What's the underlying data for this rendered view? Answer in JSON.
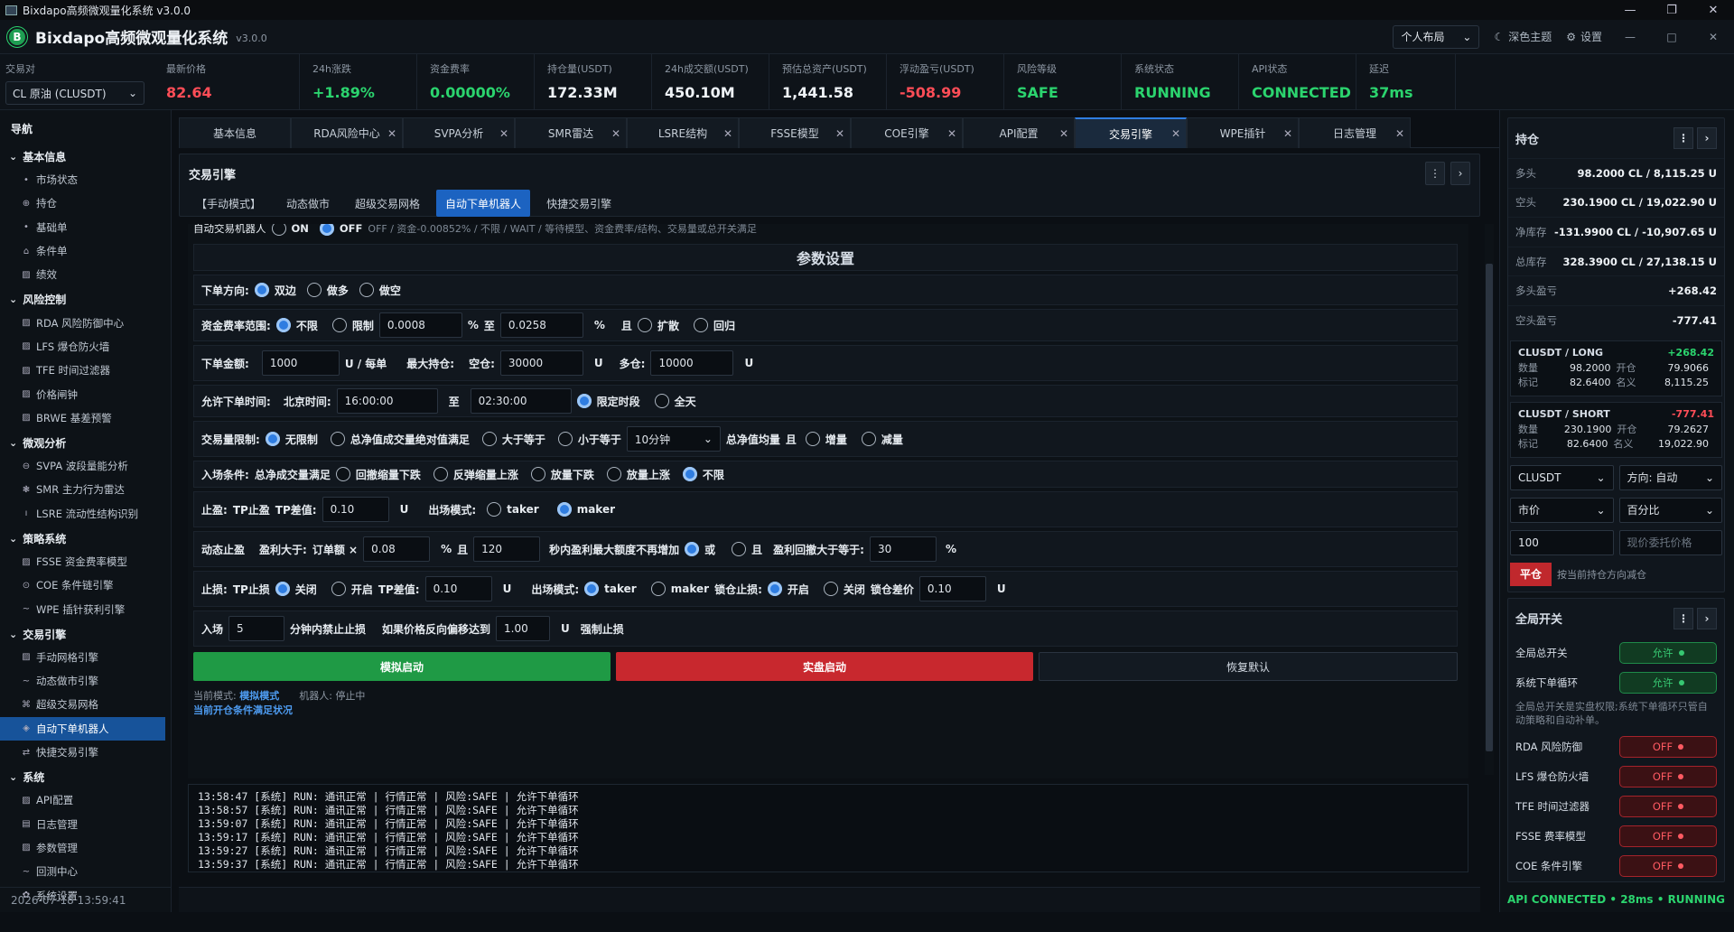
{
  "window": {
    "title": "Bixdapo高频微观量化系统 v3.0.0",
    "min": "—",
    "max": "❐",
    "close": "✕"
  },
  "app": {
    "logo": "B",
    "title": "Bixdapo高频微观量化系统",
    "version": "v3.0.0",
    "layout": "个人布局",
    "theme": "深色主题",
    "settings": "设置",
    "min": "—",
    "max": "□",
    "close": "✕"
  },
  "pair": {
    "label": "交易对",
    "value": "CL 原油 (CLUSDT)"
  },
  "stats": [
    {
      "label": "最新价格",
      "value": "82.64",
      "color": "#ff4d57"
    },
    {
      "label": "24h涨跌",
      "value": "+1.89%",
      "color": "#2bd46e"
    },
    {
      "label": "资金费率",
      "value": "0.00000%",
      "color": "#2bd46e"
    },
    {
      "label": "持仓量(USDT)",
      "value": "172.33M",
      "color": "#eef2f6"
    },
    {
      "label": "24h成交额(USDT)",
      "value": "450.10M",
      "color": "#eef2f6"
    },
    {
      "label": "预估总资产(USDT)",
      "value": "1,441.58",
      "color": "#eef2f6"
    },
    {
      "label": "浮动盈亏(USDT)",
      "value": "-508.99",
      "color": "#ff4d57"
    },
    {
      "label": "风险等级",
      "value": "SAFE",
      "color": "#2bd46e"
    },
    {
      "label": "系统状态",
      "value": "RUNNING",
      "color": "#2bd46e"
    },
    {
      "label": "API状态",
      "value": "CONNECTED",
      "color": "#2bd46e"
    },
    {
      "label": "延迟",
      "value": "37ms",
      "color": "#2bd46e"
    }
  ],
  "sidebar": {
    "title": "导航",
    "groups": [
      {
        "label": "基本信息",
        "items": [
          {
            "icon": "•",
            "label": "市场状态"
          },
          {
            "icon": "⊕",
            "label": "持仓"
          },
          {
            "icon": "•",
            "label": "基础单"
          },
          {
            "icon": "⌂",
            "label": "条件单"
          },
          {
            "icon": "▨",
            "label": "绩效"
          }
        ]
      },
      {
        "label": "风险控制",
        "items": [
          {
            "icon": "▨",
            "label": "RDA 风险防御中心"
          },
          {
            "icon": "▨",
            "label": "LFS 爆仓防火墙"
          },
          {
            "icon": "▨",
            "label": "TFE 时间过滤器"
          },
          {
            "icon": "▨",
            "label": "价格闸钟"
          },
          {
            "icon": "▨",
            "label": "BRWE 基差预警"
          }
        ]
      },
      {
        "label": "微观分析",
        "items": [
          {
            "icon": "⊖",
            "label": "SVPA 波段量能分析"
          },
          {
            "icon": "❃",
            "label": "SMR 主力行为雷达"
          },
          {
            "icon": "ı",
            "label": "LSRE 流动性结构识别"
          }
        ]
      },
      {
        "label": "策略系统",
        "items": [
          {
            "icon": "▨",
            "label": "FSSE 资金费率模型"
          },
          {
            "icon": "⊙",
            "label": "COE 条件链引擎"
          },
          {
            "icon": "~",
            "label": "WPE 插针获利引擎"
          }
        ]
      },
      {
        "label": "交易引擎",
        "items": [
          {
            "icon": "▨",
            "label": "手动网格引擎"
          },
          {
            "icon": "~",
            "label": "动态做市引擎"
          },
          {
            "icon": "⌘",
            "label": "超级交易网格"
          },
          {
            "icon": "◈",
            "label": "自动下单机器人",
            "active": true
          },
          {
            "icon": "⇄",
            "label": "快捷交易引擎"
          }
        ]
      },
      {
        "label": "系统",
        "items": [
          {
            "icon": "▨",
            "label": "API配置"
          },
          {
            "icon": "▤",
            "label": "日志管理"
          },
          {
            "icon": "▨",
            "label": "参数管理"
          },
          {
            "icon": "~",
            "label": "回测中心"
          },
          {
            "icon": "✿",
            "label": "系统设置"
          }
        ]
      }
    ],
    "footer": "2026-07-18 13:59:41"
  },
  "tabs": [
    {
      "label": "基本信息"
    },
    {
      "label": "RDA风险中心"
    },
    {
      "label": "SVPA分析"
    },
    {
      "label": "SMR雷达"
    },
    {
      "label": "LSRE结构"
    },
    {
      "label": "FSSE模型"
    },
    {
      "label": "COE引擎"
    },
    {
      "label": "API配置"
    },
    {
      "label": "交易引擎",
      "active": true
    },
    {
      "label": "WPE插针"
    },
    {
      "label": "日志管理"
    }
  ],
  "engine": {
    "title": "交易引擎",
    "subtabs": [
      {
        "label": "【手动模式】"
      },
      {
        "label": "动态做市"
      },
      {
        "label": "超级交易网格"
      },
      {
        "label": "自动下单机器人",
        "active": true
      },
      {
        "label": "快捷交易引擎"
      }
    ]
  },
  "form": {
    "auto": {
      "label": "自动交易机器人",
      "on": "ON",
      "off": "OFF",
      "desc": "OFF / 资金-0.00852% / 不限 / WAIT / 等待模型、资金费率/结构、交易量或总开关满足"
    },
    "title": "参数设置",
    "dir": {
      "label": "下单方向:",
      "o1": "双边",
      "o2": "做多",
      "o3": "做空"
    },
    "fund": {
      "label": "资金费率范围:",
      "o1": "不限",
      "o2": "限制",
      "v1": "0.0008",
      "pct": "%",
      "to": "至",
      "v2": "0.0258",
      "pct2": "%",
      "and": "且",
      "o3": "扩散",
      "o4": "回归"
    },
    "amt": {
      "label": "下单金额:",
      "v": "1000",
      "unit": "U / 每单",
      "maxl": "最大持仓:",
      "short": "空仓:",
      "sv": "30000",
      "u1": "U",
      "long": "多仓:",
      "lv": "10000",
      "u2": "U"
    },
    "time": {
      "label": "允许下单时间:",
      "bj": "北京时间:",
      "t1": "16:00:00",
      "to": "至",
      "t2": "02:30:00",
      "o1": "限定时段",
      "o2": "全天"
    },
    "vol": {
      "label": "交易量限制:",
      "o1": "无限制",
      "o2": "总净值成交量绝对值满足",
      "o3": "大于等于",
      "o4": "小于等于",
      "sel": "10分钟",
      "avg": "总净值均量",
      "and": "且",
      "o5": "增量",
      "o6": "减量"
    },
    "entry": {
      "label": "入场条件:",
      "sub": "总净成交量满足",
      "o1": "回撤缩量下跌",
      "o2": "反弹缩量上涨",
      "o3": "放量下跌",
      "o4": "放量上涨",
      "o5": "不限"
    },
    "tp": {
      "label": "止盈:",
      "tp": "TP止盈",
      "diff": "TP差值:",
      "v": "0.10",
      "u": "U",
      "exit": "出场模式:",
      "o1": "taker",
      "o2": "maker"
    },
    "dyn": {
      "label": "动态止盈",
      "gt": "盈利大于:",
      "ord": "订单额 ×",
      "v1": "0.08",
      "pct": "%",
      "and": "且",
      "v2": "120",
      "sec": "秒内盈利最大额度不再增加",
      "or": "或",
      "and2": "且",
      "pull": "盈利回撤大于等于:",
      "v3": "30",
      "pct2": "%"
    },
    "sl": {
      "label": "止损:",
      "tp": "TP止损",
      "o1": "关闭",
      "o2": "开启",
      "diff": "TP差值:",
      "v": "0.10",
      "u": "U",
      "exit": "出场模式:",
      "o3": "taker",
      "o4": "maker",
      "lock": "锁仓止损:",
      "o5": "开启",
      "o6": "关闭",
      "lockd": "锁仓差价",
      "v2": "0.10",
      "u2": "U"
    },
    "ent": {
      "label": "入场",
      "v": "5",
      "mins": "分钟内禁止止损",
      "cond": "如果价格反向偏移达到",
      "v2": "1.00",
      "u": "U",
      "force": "强制止损"
    },
    "btns": {
      "sim": "模拟启动",
      "live": "实盘启动",
      "reset": "恢复默认"
    },
    "status": {
      "mode": "当前模式:",
      "modev": "模拟模式",
      "bot": "机器人:",
      "botv": "停止中",
      "cut": "当前开仓条件满足状况"
    }
  },
  "log": [
    "13:58:47 [系统] RUN: 通讯正常 | 行情正常 | 风险:SAFE | 允许下单循环",
    "13:58:57 [系统] RUN: 通讯正常 | 行情正常 | 风险:SAFE | 允许下单循环",
    "13:59:07 [系统] RUN: 通讯正常 | 行情正常 | 风险:SAFE | 允许下单循环",
    "13:59:17 [系统] RUN: 通讯正常 | 行情正常 | 风险:SAFE | 允许下单循环",
    "13:59:27 [系统] RUN: 通讯正常 | 行情正常 | 风险:SAFE | 允许下单循环",
    "13:59:37 [系统] RUN: 通讯正常 | 行情正常 | 风险:SAFE | 允许下单循环"
  ],
  "right": {
    "pos_title": "持仓",
    "kv": [
      {
        "k": "多头",
        "v": "98.2000 CL / 8,115.25 U"
      },
      {
        "k": "空头",
        "v": "230.1900 CL / 19,022.90 U"
      },
      {
        "k": "净库存",
        "v": "-131.9900 CL / -10,907.65 U"
      },
      {
        "k": "总库存",
        "v": "328.3900 CL / 27,138.15 U"
      },
      {
        "k": "多头盈亏",
        "v": "+268.42"
      },
      {
        "k": "空头盈亏",
        "v": "-777.41"
      }
    ],
    "long": {
      "name": "CLUSDT / LONG",
      "pnl": "+268.42",
      "qtyl": "数量",
      "qty": "98.2000",
      "openl": "开仓",
      "open": "79.9066",
      "markl": "标记",
      "mark": "82.6400",
      "notl": "名义",
      "not": "8,115.25"
    },
    "short": {
      "name": "CLUSDT / SHORT",
      "pnl": "-777.41",
      "qtyl": "数量",
      "qty": "230.1900",
      "openl": "开仓",
      "open": "79.2627",
      "markl": "标记",
      "mark": "82.6400",
      "notl": "名义",
      "not": "19,022.90"
    },
    "o1": "CLUSDT",
    "o2": "方向: 自动",
    "o3": "市价",
    "o4": "百分比",
    "o5": "100",
    "o6ph": "现价委托价格",
    "close": "平仓",
    "closedesc": "按当前持仓方向减仓",
    "sw_title": "全局开关",
    "sw1": {
      "k": "全局总开关",
      "v": "允许"
    },
    "sw2": {
      "k": "系统下单循环",
      "v": "允许"
    },
    "note": "全局总开关是实盘权限;系统下单循环只管自动策略和自动补单。",
    "offs": [
      {
        "k": "RDA 风险防御",
        "v": "OFF"
      },
      {
        "k": "LFS 爆仓防火墙",
        "v": "OFF"
      },
      {
        "k": "TFE 时间过滤器",
        "v": "OFF"
      },
      {
        "k": "FSSE 费率模型",
        "v": "OFF"
      },
      {
        "k": "COE 条件引擎",
        "v": "OFF"
      }
    ],
    "footer": "API CONNECTED • 28ms • RUNNING"
  }
}
